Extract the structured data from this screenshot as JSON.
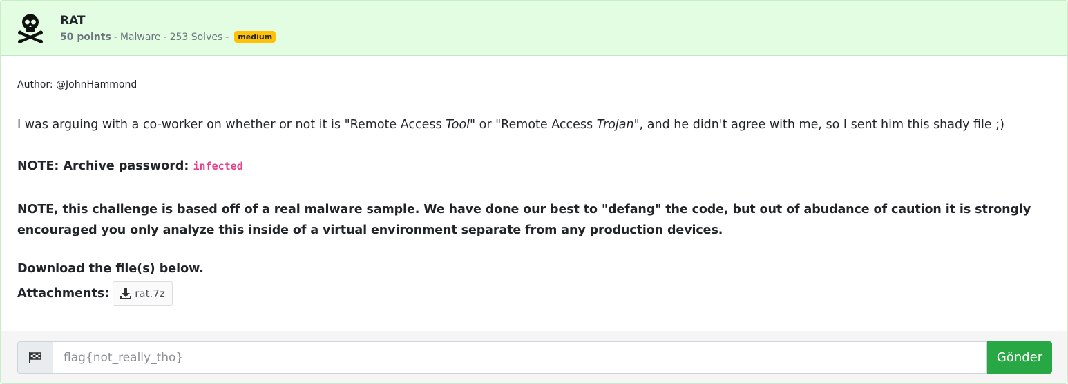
{
  "challenge": {
    "title": "RAT",
    "icon": "skull-crossbones-icon",
    "points": "50 points",
    "category": "Malware",
    "solves": "253 Solves",
    "separator": "-",
    "difficulty": "medium"
  },
  "description": {
    "author": "Author: @JohnHammond",
    "text_parts": {
      "p1": "I was arguing with a co-worker on whether or not it is \"Remote Access ",
      "em1": "Tool",
      "p2": "\" or \"Remote Access ",
      "em2": "Trojan",
      "p3": "\", and he didn't agree with me, so I sent him this shady file ;)"
    },
    "note_password_label": "NOTE: Archive password: ",
    "note_password_value": "infected",
    "note_warning": "NOTE, this challenge is based off of a real malware sample. We have done our best to \"defang\" the code, but out of abudance of caution it is strongly encouraged you only analyze this inside of a virtual environment separate from any production devices.",
    "download_text": "Download the file(s) below."
  },
  "attachments": {
    "label": "Attachments:",
    "files": [
      {
        "name": "rat.7z",
        "icon": "download-icon"
      }
    ]
  },
  "flag_form": {
    "icon": "checkered-flag-icon",
    "placeholder": "flag{not_really_tho}",
    "submit_label": "Gönder"
  },
  "colors": {
    "header_bg": "#e2fde2",
    "badge_bg": "#ffc107",
    "code_color": "#e83e8c",
    "submit_bg": "#28a745"
  }
}
